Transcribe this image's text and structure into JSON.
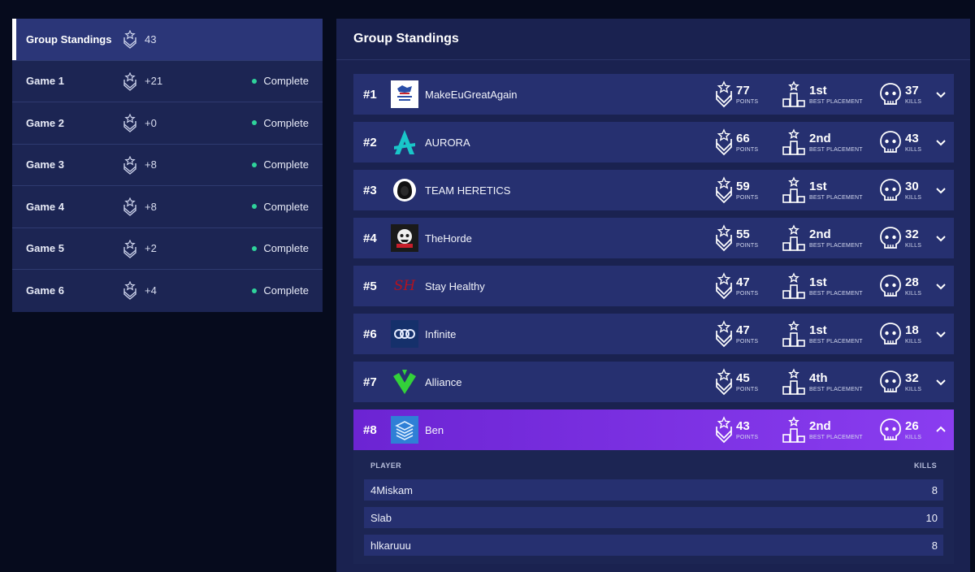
{
  "sidebar": {
    "items": [
      {
        "name": "Group Standings",
        "points": "43",
        "status": "",
        "active": true
      },
      {
        "name": "Game 1",
        "points": "+21",
        "status": "Complete"
      },
      {
        "name": "Game 2",
        "points": "+0",
        "status": "Complete"
      },
      {
        "name": "Game 3",
        "points": "+8",
        "status": "Complete"
      },
      {
        "name": "Game 4",
        "points": "+8",
        "status": "Complete"
      },
      {
        "name": "Game 5",
        "points": "+2",
        "status": "Complete"
      },
      {
        "name": "Game 6",
        "points": "+4",
        "status": "Complete"
      }
    ]
  },
  "main": {
    "title": "Group Standings",
    "labels": {
      "points": "POINTS",
      "placement": "BEST PLACEMENT",
      "kills": "KILLS"
    },
    "teams": [
      {
        "rank": "#1",
        "name": "MakeEuGreatAgain",
        "points": "77",
        "placement": "1st",
        "kills": "37",
        "logo": "meuga-logo"
      },
      {
        "rank": "#2",
        "name": "AURORA",
        "points": "66",
        "placement": "2nd",
        "kills": "43",
        "logo": "aurora-logo"
      },
      {
        "rank": "#3",
        "name": "TEAM HERETICS",
        "points": "59",
        "placement": "1st",
        "kills": "30",
        "logo": "heretics-logo"
      },
      {
        "rank": "#4",
        "name": "TheHorde",
        "points": "55",
        "placement": "2nd",
        "kills": "32",
        "logo": "horde-logo"
      },
      {
        "rank": "#5",
        "name": "Stay Healthy",
        "points": "47",
        "placement": "1st",
        "kills": "28",
        "logo": "stay-healthy-logo",
        "logo_text": "SH"
      },
      {
        "rank": "#6",
        "name": "Infinite",
        "points": "47",
        "placement": "1st",
        "kills": "18",
        "logo": "infinite-logo"
      },
      {
        "rank": "#7",
        "name": "Alliance",
        "points": "45",
        "placement": "4th",
        "kills": "32",
        "logo": "alliance-logo"
      },
      {
        "rank": "#8",
        "name": "Ben",
        "points": "43",
        "placement": "2nd",
        "kills": "26",
        "logo": "ben-logo",
        "selected": true
      }
    ],
    "expanded": {
      "header_player": "PLAYER",
      "header_kills": "KILLS",
      "players": [
        {
          "name": "4Miskam",
          "kills": "8"
        },
        {
          "name": "Slab",
          "kills": "10"
        },
        {
          "name": "hlkaruuu",
          "kills": "8"
        }
      ]
    }
  },
  "colors": {
    "background": "#060b1d",
    "panel": "#1c2553",
    "row": "#263070",
    "selected_gradient_start": "#6c24d3",
    "selected_gradient_end": "#8a3df0",
    "status_dot": "#2fd39b"
  },
  "icons": {
    "points": "shield-star-icon",
    "placement": "podium-star-icon",
    "kills": "skull-icon",
    "expand": "chevron-down-icon",
    "collapse": "chevron-up-icon"
  }
}
